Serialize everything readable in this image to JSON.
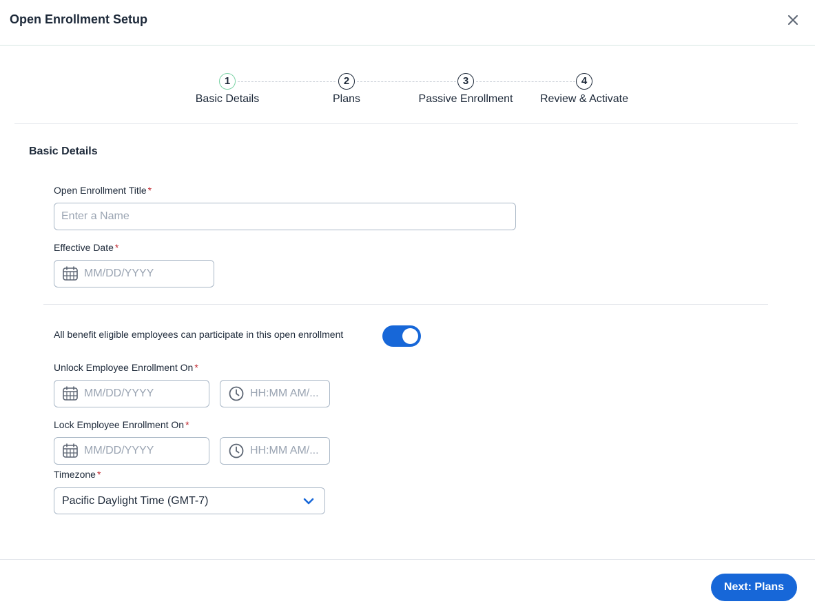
{
  "header": {
    "title": "Open Enrollment Setup"
  },
  "icons": {
    "close": "close-icon",
    "calendar": "calendar-icon",
    "clock": "clock-icon",
    "chevron": "chevron-down-icon"
  },
  "colors": {
    "primary": "#1767d8",
    "active_step": "#7dd3a6",
    "required": "#c0262d",
    "text": "#1d2939"
  },
  "stepper": {
    "steps": [
      {
        "number": "1",
        "label": "Basic Details",
        "active": true
      },
      {
        "number": "2",
        "label": "Plans",
        "active": false
      },
      {
        "number": "3",
        "label": "Passive Enrollment",
        "active": false
      },
      {
        "number": "4",
        "label": "Review & Activate",
        "active": false
      }
    ]
  },
  "form": {
    "section_title": "Basic Details",
    "required_mark": "*",
    "title": {
      "label": "Open Enrollment Title",
      "placeholder": "Enter a Name",
      "value": ""
    },
    "effective_date": {
      "label": "Effective Date",
      "placeholder": "MM/DD/YYYY",
      "value": ""
    },
    "eligibility_toggle": {
      "label": "All benefit eligible employees can participate in this open enrollment",
      "on": true
    },
    "unlock": {
      "label": "Unlock Employee Enrollment On",
      "date_placeholder": "MM/DD/YYYY",
      "time_placeholder": "HH:MM AM/..."
    },
    "lock": {
      "label": "Lock Employee Enrollment On",
      "date_placeholder": "MM/DD/YYYY",
      "time_placeholder": "HH:MM AM/..."
    },
    "timezone": {
      "label": "Timezone",
      "selected": "Pacific Daylight Time (GMT-7)"
    }
  },
  "footer": {
    "next_label": "Next: Plans"
  }
}
